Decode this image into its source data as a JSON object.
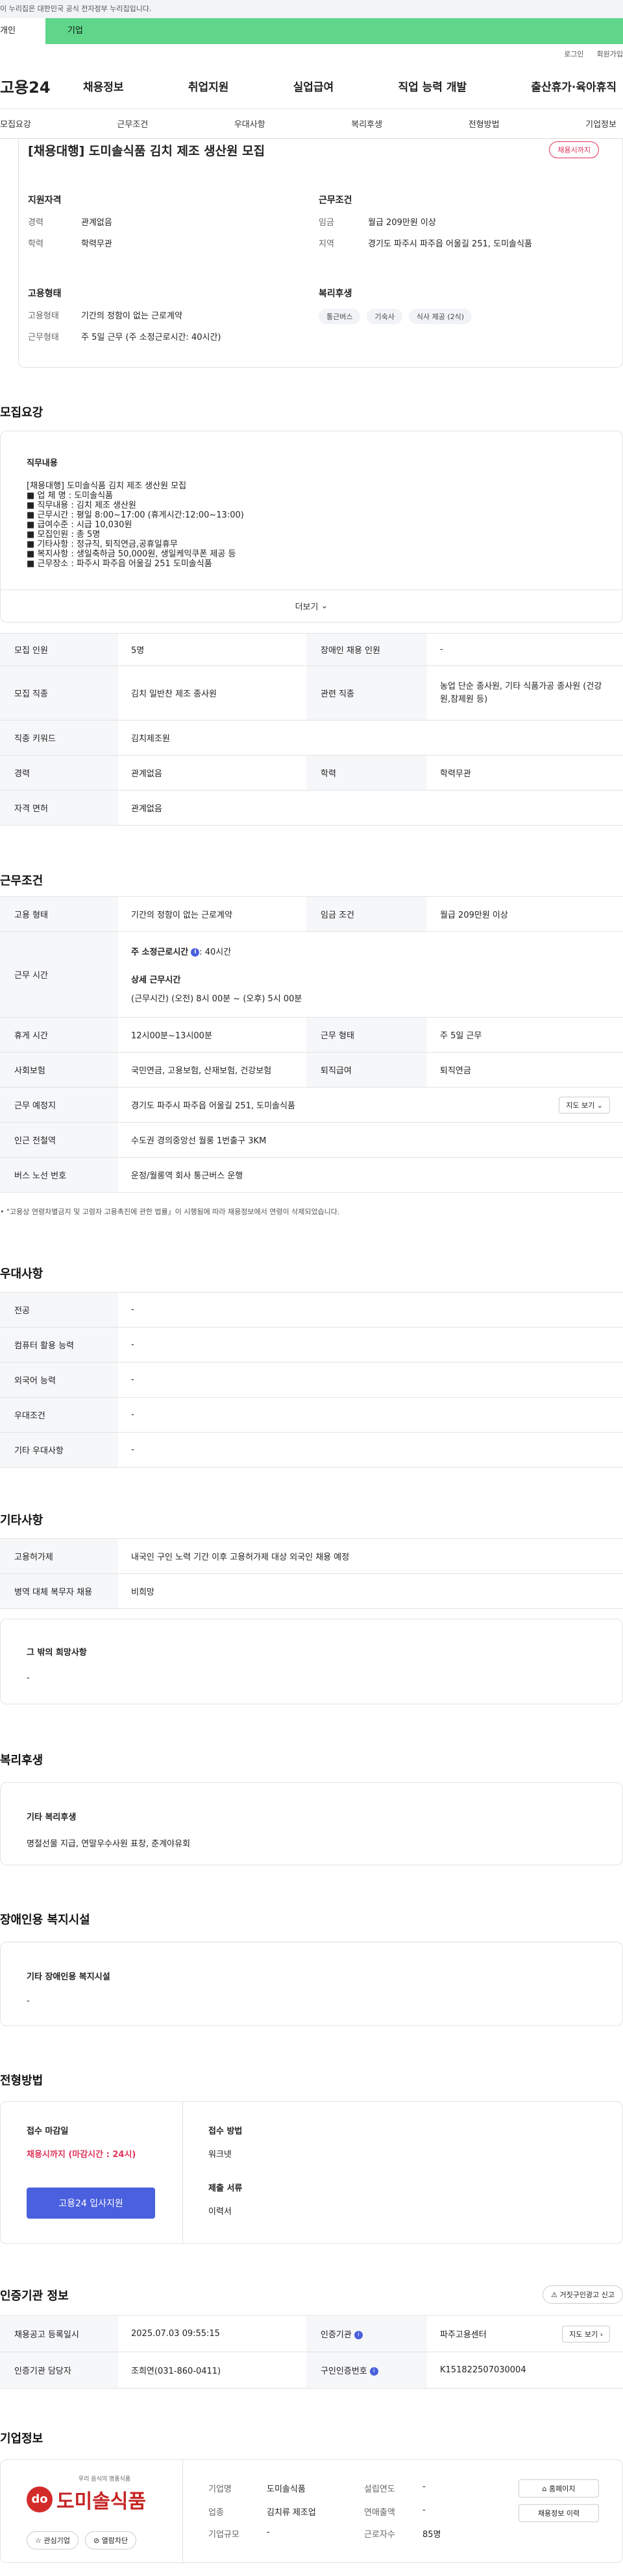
{
  "gov_banner": "이 누리집은 대한민국 공식 전자정부 누리집입니다.",
  "type_tabs": {
    "personal": "개인",
    "company": "기업"
  },
  "util": {
    "login": "로그인",
    "join": "회원가입"
  },
  "logo": "고용24",
  "gnb": [
    "채용정보",
    "취업지원",
    "실업급여",
    "직업 능력 개발",
    "출산휴가·육아휴직"
  ],
  "anchors": [
    "모집요강",
    "근무조건",
    "우대사항",
    "복리후생",
    "전형방법",
    "기업정보"
  ],
  "summary": {
    "title": "[채용대행] 도미솔식품 김치 제조 생산원 모집",
    "badge": "채용시까지",
    "qual_title": "지원자격",
    "qual": [
      {
        "k": "경력",
        "v": "관계없음"
      },
      {
        "k": "학력",
        "v": "학력무관"
      }
    ],
    "cond_title": "근무조건",
    "cond": [
      {
        "k": "임금",
        "v": "월급 209만원 이상"
      },
      {
        "k": "지역",
        "v": "경기도 파주시 파주읍 어울길 251, 도미솔식품"
      }
    ],
    "emp_title": "고용형태",
    "emp": [
      {
        "k": "고용형태",
        "v": "기간의 정함이 없는 근로계약"
      },
      {
        "k": "근무형태",
        "v": "주 5일 근무 (주 소정근로시간: 40시간)"
      }
    ],
    "welfare_title": "복리후생",
    "welfare_tags": [
      "통근버스",
      "기숙사",
      "식사 제공 (2식)"
    ]
  },
  "recruit": {
    "title": "모집요강",
    "desc_heading": "직무내용",
    "desc_lines": [
      "[채용대행] 도미솔식품 김치 제조 생산원 모집",
      "■ 업 체 명 : 도미솔식품",
      "■ 직무내용 : 김치 제조 생산원",
      "■ 근무시간 : 평일 8:00~17:00 (휴게시간:12:00~13:00)",
      "■ 급여수준 : 시급 10,030원",
      "■ 모집인원 : 총 5명",
      "■ 기타사항 : 정규직, 퇴직연금,공휴일휴무",
      "■ 복지사항 : 생일축하금 50,000원, 생일케익쿠폰 제공 등",
      "■ 근무장소 : 파주시 파주읍 어울길 251 도미솔식품"
    ],
    "more": "더보기",
    "rows": [
      {
        "k": "모집 인원",
        "v": "5명",
        "k2": "장애인 채용 인원",
        "v2": "-"
      },
      {
        "k": "모집 직종",
        "v": "김치 일반찬 제조 종사원",
        "k2": "관련 직종",
        "v2": "농업 단순 종사원, 기타 식품가공 종사원 (건강원,참제원 등)"
      },
      {
        "k": "직종 키워드",
        "v": "김치제조원",
        "k2": "",
        "v2": ""
      },
      {
        "k": "경력",
        "v": "관계없음",
        "k2": "학력",
        "v2": "학력무관"
      },
      {
        "k": "자격 면허",
        "v": "관계없음",
        "k2": "",
        "v2": ""
      }
    ]
  },
  "conditions": {
    "title": "근무조건",
    "employ_type_k": "고용 형태",
    "employ_type_v": "기간의 정함이 없는 근로계약",
    "wage_k": "임금 조건",
    "wage_v": "월급 209만원 이상",
    "hours_k": "근무 시간",
    "hours_weekly": "주 소정근로시간",
    "hours_weekly_v": ": 40시간",
    "hours_detail_title": "상세 근무시간",
    "hours_detail": "(근무시간) (오전) 8시 00분 ~ (오후) 5시 00분",
    "break_k": "휴게 시간",
    "break_v": "12시00분~13시00분",
    "form_k": "근무 형태",
    "form_v": "주 5일 근무",
    "insurance_k": "사회보험",
    "insurance_v": "국민연금, 고용보험, 산재보험, 건강보험",
    "retire_k": "퇴직급여",
    "retire_v": "퇴직연금",
    "place_k": "근무 예정지",
    "place_v": "경기도 파주시 파주읍 어울길 251, 도미솔식품",
    "map_btn": "지도 보기",
    "station_k": "인근 전철역",
    "station_v": "수도권 경의중앙선 월롱 1번출구 3KM",
    "bus_k": "버스 노선 번호",
    "bus_v": "운정/월롱역 회사 통근버스 운행",
    "notice": "\"고용상 연령차별금지 및 고령자 고용촉진에 관한 법률」이 시행됨에 따라 채용정보에서 연령이 삭제되었습니다."
  },
  "preference": {
    "title": "우대사항",
    "rows": [
      {
        "k": "전공",
        "v": "-"
      },
      {
        "k": "컴퓨터 활용 능력",
        "v": "-"
      },
      {
        "k": "외국어 능력",
        "v": "-"
      },
      {
        "k": "우대조건",
        "v": "-"
      },
      {
        "k": "기타 우대사항",
        "v": "-"
      }
    ]
  },
  "etc": {
    "title": "기타사항",
    "rows": [
      {
        "k": "고용허가제",
        "v": "내국인 구인 노력 기간 이후 고용허가제 대상 외국인 채용 예정"
      },
      {
        "k": "병역 대체 복무자 채용",
        "v": "비희망"
      }
    ],
    "other_title": "그 밖의 희망사항",
    "other_v": "-"
  },
  "welfare": {
    "title": "복리후생",
    "sub_title": "기타 복리후생",
    "v": "명절선물 지급, 연말우수사원 표창, 춘계야유회"
  },
  "disabled": {
    "title": "장애인용 복지시설",
    "sub_title": "기타 장애인용 복지시설",
    "v": "-"
  },
  "selection": {
    "title": "전형방법",
    "deadline_k": "접수 마감일",
    "deadline_v": "채용시까지 (마감시간 : 24시)",
    "apply_btn": "고용24 입사지원",
    "method_k": "접수 방법",
    "method_v": "워크넷",
    "docs_k": "제출 서류",
    "docs_v": "이력서"
  },
  "cert": {
    "title": "인증기관 정보",
    "report_btn": "거짓구인광고 신고",
    "reg_k": "채용공고 등록일시",
    "reg_v": "2025.07.03 09:55:15",
    "org_k": "인증기관",
    "org_v": "파주고용센터",
    "map_btn": "지도 보기",
    "manager_k": "인증기관 담당자",
    "manager_v": "조희연(031-860-0411)",
    "auth_k": "구인인증번호",
    "auth_v": "K151822507030004"
  },
  "company": {
    "title": "기업정보",
    "logo_small": "우리 음식의 명품식품",
    "logo_name": "도미솔식품",
    "interest_btn": "관심기업",
    "block_btn": "열람차단",
    "name_k": "기업명",
    "name_v": "도미솔식품",
    "industry_k": "업종",
    "industry_v": "김치류 제조업",
    "size_k": "기업규모",
    "size_v": "-",
    "founded_k": "설립연도",
    "founded_v": "-",
    "revenue_k": "연매출액",
    "revenue_v": "-",
    "employees_k": "근로자수",
    "employees_v": "85명",
    "homepage_btn": "홈페이지",
    "history_btn": "채용정보 이력"
  }
}
